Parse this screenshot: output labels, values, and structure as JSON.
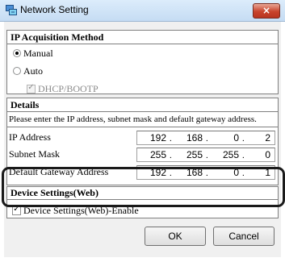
{
  "window": {
    "title": "Network Setting",
    "close_label": "×"
  },
  "ip_acquisition": {
    "header": "IP Acquisition Method",
    "options": [
      {
        "label": "Manual",
        "selected": true
      },
      {
        "label": "Auto",
        "selected": false
      }
    ],
    "dhcp": {
      "label": "DHCP/BOOTP",
      "checked": true,
      "enabled": false
    }
  },
  "details": {
    "header": "Details",
    "instructions": "Please enter the IP address, subnet mask and default gateway address.",
    "fields": [
      {
        "label": "IP Address",
        "octets": [
          "192",
          "168",
          "0",
          "2"
        ]
      },
      {
        "label": "Subnet Mask",
        "octets": [
          "255",
          "255",
          "255",
          "0"
        ]
      },
      {
        "label": "Default Gateway Address",
        "octets": [
          "192",
          "168",
          "0",
          "1"
        ]
      }
    ],
    "ip_separator": "."
  },
  "device_settings": {
    "header": "Device Settings(Web)",
    "enable": {
      "label": "Device Settings(Web)-Enable",
      "checked": true
    }
  },
  "buttons": {
    "ok": "OK",
    "cancel": "Cancel"
  },
  "colors": {
    "close_button": "#c8432c",
    "highlight_outline": "#1a1a1a"
  }
}
